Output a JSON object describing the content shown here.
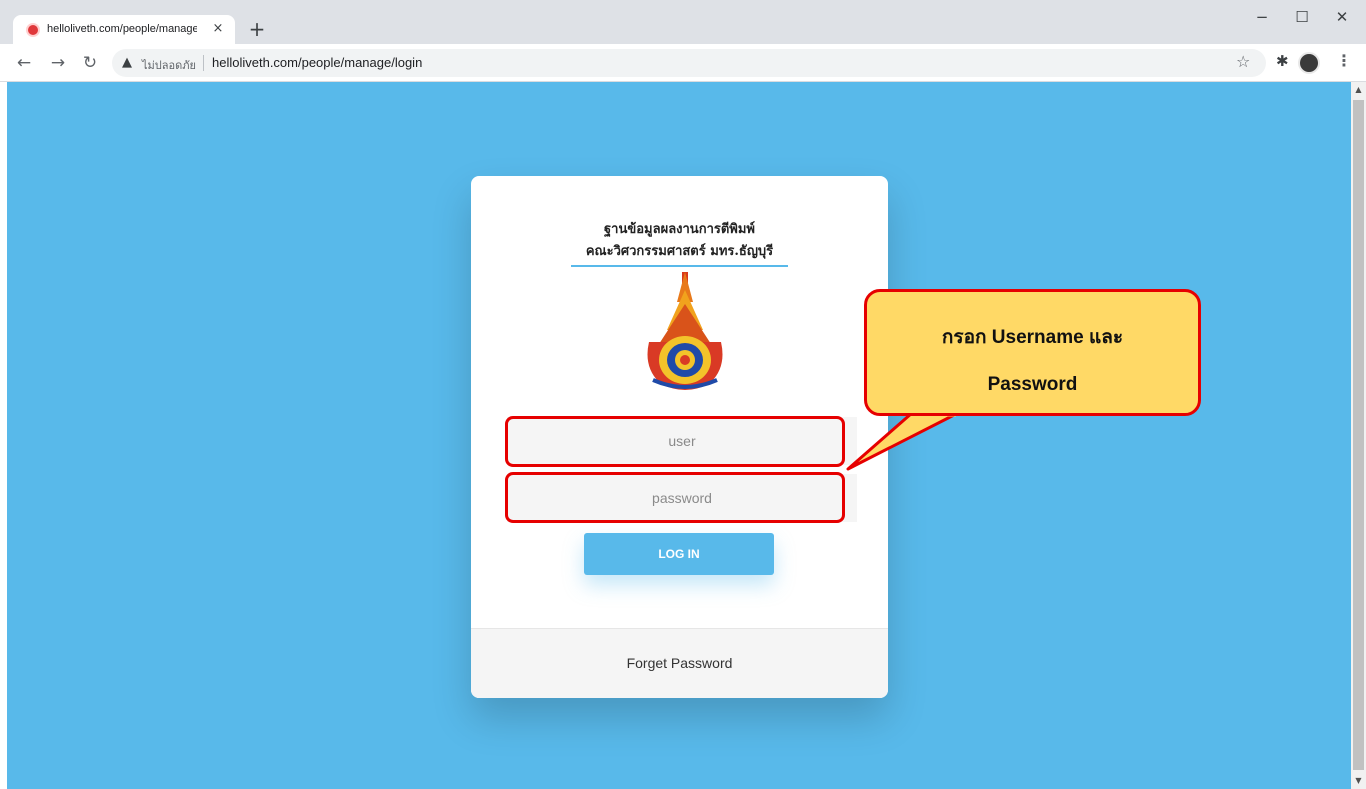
{
  "browser": {
    "tab_title": "helloliveth.com/people/manage/",
    "tab_close": "×",
    "new_tab": "+",
    "security_label": "ไม่ปลอดภัย",
    "url": "helloliveth.com/people/manage/login",
    "window_controls": {
      "minimize": "−",
      "maximize": "☐",
      "close": "✕"
    }
  },
  "login": {
    "title_line1": "ฐานข้อมูลผลงานการตีพิมพ์",
    "title_line2": "คณะวิศวกรรมศาสตร์ มทร.ธัญบุรี",
    "username_placeholder": "user",
    "password_placeholder": "password",
    "login_button": "LOG IN",
    "forget_password": "Forget Password"
  },
  "callout": {
    "line1": "กรอก Username และ",
    "line2": "Password"
  },
  "icons": {
    "back": "arrow-left-icon",
    "forward": "arrow-right-icon",
    "reload": "reload-icon",
    "warning": "warning-icon",
    "bookmark": "star-icon",
    "extensions": "puzzle-icon",
    "menu": "kebab-menu-icon"
  },
  "colors": {
    "page_background": "#58b9ea",
    "highlight": "#e60000",
    "callout_fill": "#ffd966"
  }
}
